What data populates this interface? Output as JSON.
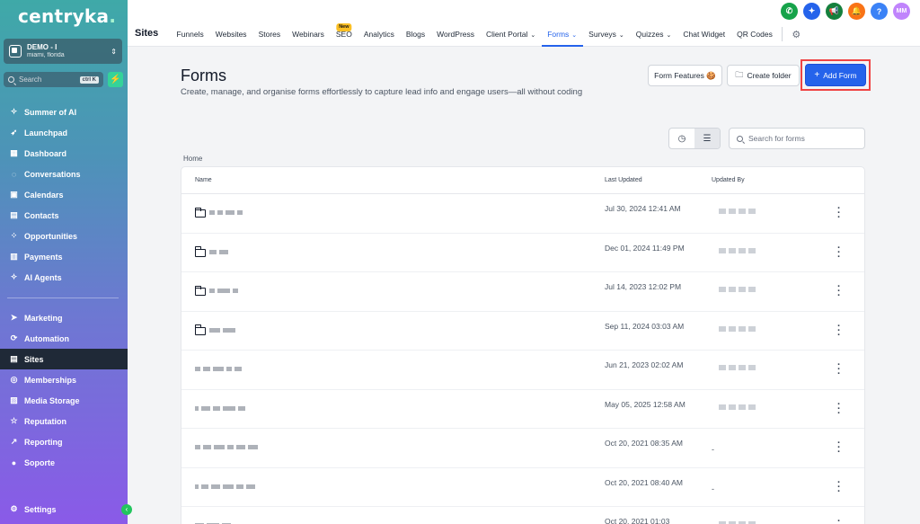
{
  "sidebar": {
    "logo": "centryka",
    "account": {
      "name": "DEMO - I",
      "location": "miami, florida"
    },
    "search": {
      "label": "Search",
      "shortcut": "ctrl K"
    },
    "items": [
      {
        "label": "Summer of AI",
        "icon": "sparkle-icon"
      },
      {
        "label": "Launchpad",
        "icon": "rocket-icon"
      },
      {
        "label": "Dashboard",
        "icon": "dashboard-icon"
      },
      {
        "label": "Conversations",
        "icon": "chat-icon"
      },
      {
        "label": "Calendars",
        "icon": "calendar-icon"
      },
      {
        "label": "Contacts",
        "icon": "contacts-icon"
      },
      {
        "label": "Opportunities",
        "icon": "opportunities-icon"
      },
      {
        "label": "Payments",
        "icon": "payments-icon"
      },
      {
        "label": "AI Agents",
        "icon": "ai-agents-icon"
      }
    ],
    "items2": [
      {
        "label": "Marketing",
        "icon": "send-icon"
      },
      {
        "label": "Automation",
        "icon": "automation-icon"
      },
      {
        "label": "Sites",
        "icon": "sites-icon",
        "active": true
      },
      {
        "label": "Memberships",
        "icon": "membership-icon"
      },
      {
        "label": "Media Storage",
        "icon": "media-icon"
      },
      {
        "label": "Reputation",
        "icon": "star-icon"
      },
      {
        "label": "Reporting",
        "icon": "reporting-icon"
      },
      {
        "label": "Soporte",
        "icon": "support-icon"
      }
    ],
    "settings": "Settings"
  },
  "topbar": {
    "title": "Sites",
    "tabs": [
      {
        "label": "Funnels"
      },
      {
        "label": "Websites"
      },
      {
        "label": "Stores"
      },
      {
        "label": "Webinars"
      },
      {
        "label": "SEO",
        "badge": "New"
      },
      {
        "label": "Analytics"
      },
      {
        "label": "Blogs"
      },
      {
        "label": "WordPress"
      },
      {
        "label": "Client Portal",
        "dropdown": true
      },
      {
        "label": "Forms",
        "dropdown": true,
        "active": true
      },
      {
        "label": "Surveys",
        "dropdown": true
      },
      {
        "label": "Quizzes",
        "dropdown": true
      },
      {
        "label": "Chat Widget"
      },
      {
        "label": "QR Codes"
      }
    ],
    "icons": [
      {
        "name": "phone-icon",
        "color": "#16a34a",
        "glyph": "✆"
      },
      {
        "name": "magic-icon",
        "color": "#2563eb",
        "glyph": "✦"
      },
      {
        "name": "megaphone-icon",
        "color": "#15803d",
        "glyph": "📢"
      },
      {
        "name": "bell-icon",
        "color": "#f97316",
        "glyph": "🔔"
      },
      {
        "name": "help-icon",
        "color": "#3b82f6",
        "glyph": "?"
      },
      {
        "name": "avatar",
        "color": "#c084fc",
        "glyph": "MM"
      }
    ]
  },
  "page": {
    "title": "Forms",
    "subtitle": "Create, manage, and organise forms effortlessly to capture lead info and engage users—all without coding",
    "buttons": {
      "features": "Form Features 🍪",
      "create_folder": "Create folder",
      "add_form": "Add Form"
    },
    "search_placeholder": "Search for forms",
    "breadcrumb": "Home",
    "columns": {
      "name": "Name",
      "updated": "Last Updated",
      "by": "Updated By"
    },
    "rows": [
      {
        "folder": true,
        "date": "Jul 30, 2024 12:41 AM",
        "by": ""
      },
      {
        "folder": true,
        "date": "Dec 01, 2024 11:49 PM",
        "by": ""
      },
      {
        "folder": true,
        "date": "Jul 14, 2023 12:02 PM",
        "by": ""
      },
      {
        "folder": true,
        "date": "Sep 11, 2024 03:03 AM",
        "by": ""
      },
      {
        "folder": false,
        "date": "Jun 21, 2023 02:02 AM",
        "by": ""
      },
      {
        "folder": false,
        "date": "May 05, 2025 12:58 AM",
        "by": ""
      },
      {
        "folder": false,
        "date": "Oct 20, 2021 08:35 AM",
        "by": "-"
      },
      {
        "folder": false,
        "date": "Oct 20, 2021 08:40 AM",
        "by": "-"
      },
      {
        "folder": false,
        "date": "Oct 20, 2021 01:03",
        "by": ""
      }
    ]
  },
  "colors": {
    "accent": "#2563eb",
    "highlight": "#ef4444",
    "active_nav": "#1f2937"
  }
}
